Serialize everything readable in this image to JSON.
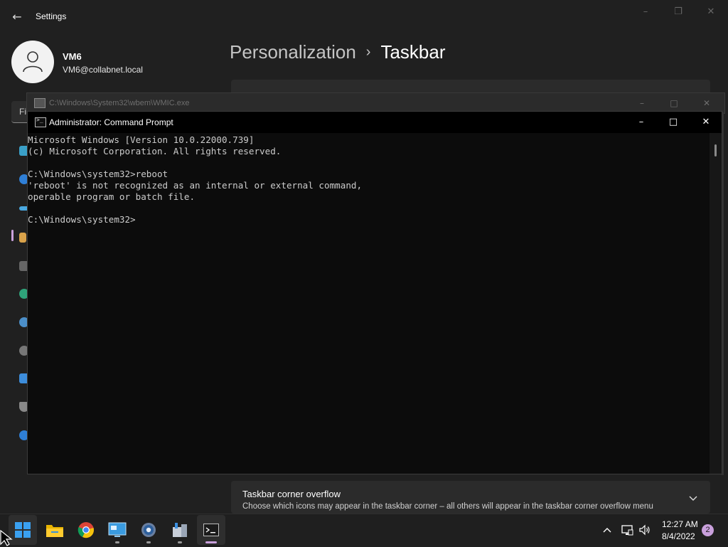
{
  "settings": {
    "window_title": "Settings",
    "user_name": "VM6",
    "user_email": "VM6@collabnet.local",
    "find_placeholder": "Fi",
    "breadcrumb_parent": "Personalization",
    "breadcrumb_separator": "›",
    "breadcrumb_current": "Taskbar",
    "overflow_title": "Taskbar corner overflow",
    "overflow_desc": "Choose which icons may appear in the taskbar corner – all others will appear in the taskbar corner overflow menu"
  },
  "wmic": {
    "title": "C:\\Windows\\System32\\wbem\\WMIC.exe"
  },
  "cmd": {
    "title": "Administrator: Command Prompt",
    "lines": [
      "Microsoft Windows [Version 10.0.22000.739]",
      "(c) Microsoft Corporation. All rights reserved.",
      "",
      "C:\\Windows\\system32>reboot",
      "'reboot' is not recognized as an internal or external command,",
      "operable program or batch file.",
      "",
      "C:\\Windows\\system32>"
    ]
  },
  "taskbar": {
    "apps": [
      "start-icon",
      "file-explorer-icon",
      "chrome-icon",
      "remote-desktop-icon",
      "settings-icon",
      "server-manager-icon",
      "terminal-icon"
    ],
    "clock_time": "12:27 AM",
    "clock_date": "8/4/2022",
    "notification_count": "2"
  },
  "colors": {
    "accent": "#c9a0dc",
    "windows_blue": "#3aa0f0"
  }
}
